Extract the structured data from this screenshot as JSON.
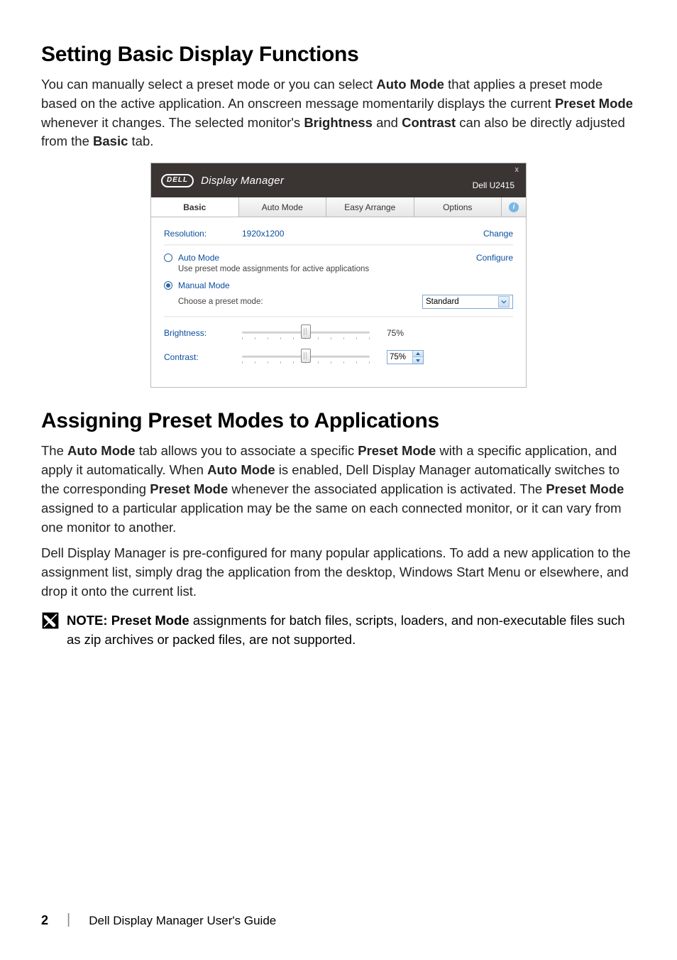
{
  "sections": {
    "s1_title": "Setting Basic Display Functions",
    "s1_para_parts": [
      "You can manually select a preset mode or you can select ",
      "Auto Mode",
      " that applies a preset mode based on the active application. An onscreen message momentarily displays the current ",
      "Preset Mode",
      " whenever it changes. The selected monitor's ",
      "Brightness",
      " and ",
      "Contrast",
      " can also be directly adjusted from the ",
      "Basic",
      " tab."
    ],
    "s2_title": "Assigning Preset Modes to Applications",
    "s2_p1_parts": [
      "The ",
      "Auto Mode",
      " tab allows you to associate a specific ",
      "Preset Mode",
      " with a specific application, and apply it automatically. When ",
      "Auto Mode",
      " is enabled, Dell Display Manager automatically switches to the corresponding ",
      "Preset Mode",
      " whenever the associated application is activated. The ",
      "Preset Mode",
      " assigned to a particular application may be the same on each connected monitor, or it can vary from one monitor to another."
    ],
    "s2_p2": "Dell Display Manager is pre-configured for many popular applications. To add a new application to the assignment list, simply drag the application from the desktop, Windows Start Menu or elsewhere, and drop it onto the current list.",
    "note_parts": [
      "NOTE: Preset Mode",
      " assignments for batch files, scripts, loaders, and non-executable files such as zip archives or packed files, are not supported."
    ]
  },
  "dialog": {
    "logo": "DELL",
    "title": "Display Manager",
    "model": "Dell U2415",
    "close": "x",
    "tabs": [
      "Basic",
      "Auto Mode",
      "Easy Arrange",
      "Options"
    ],
    "active_tab_index": 0,
    "resolution_label": "Resolution:",
    "resolution_value": "1920x1200",
    "change_link": "Change",
    "auto_mode_label": "Auto Mode",
    "auto_mode_sub": "Use preset mode assignments for active applications",
    "configure_link": "Configure",
    "manual_mode_label": "Manual Mode",
    "manual_mode_sub": "Choose a preset mode:",
    "preset_value": "Standard",
    "brightness_label": "Brightness:",
    "brightness_value": "75%",
    "brightness_slider_percent": 50,
    "contrast_label": "Contrast:",
    "contrast_value": "75%",
    "contrast_slider_percent": 50
  },
  "footer": {
    "page_number": "2",
    "doc_title": "Dell Display Manager User's Guide"
  }
}
